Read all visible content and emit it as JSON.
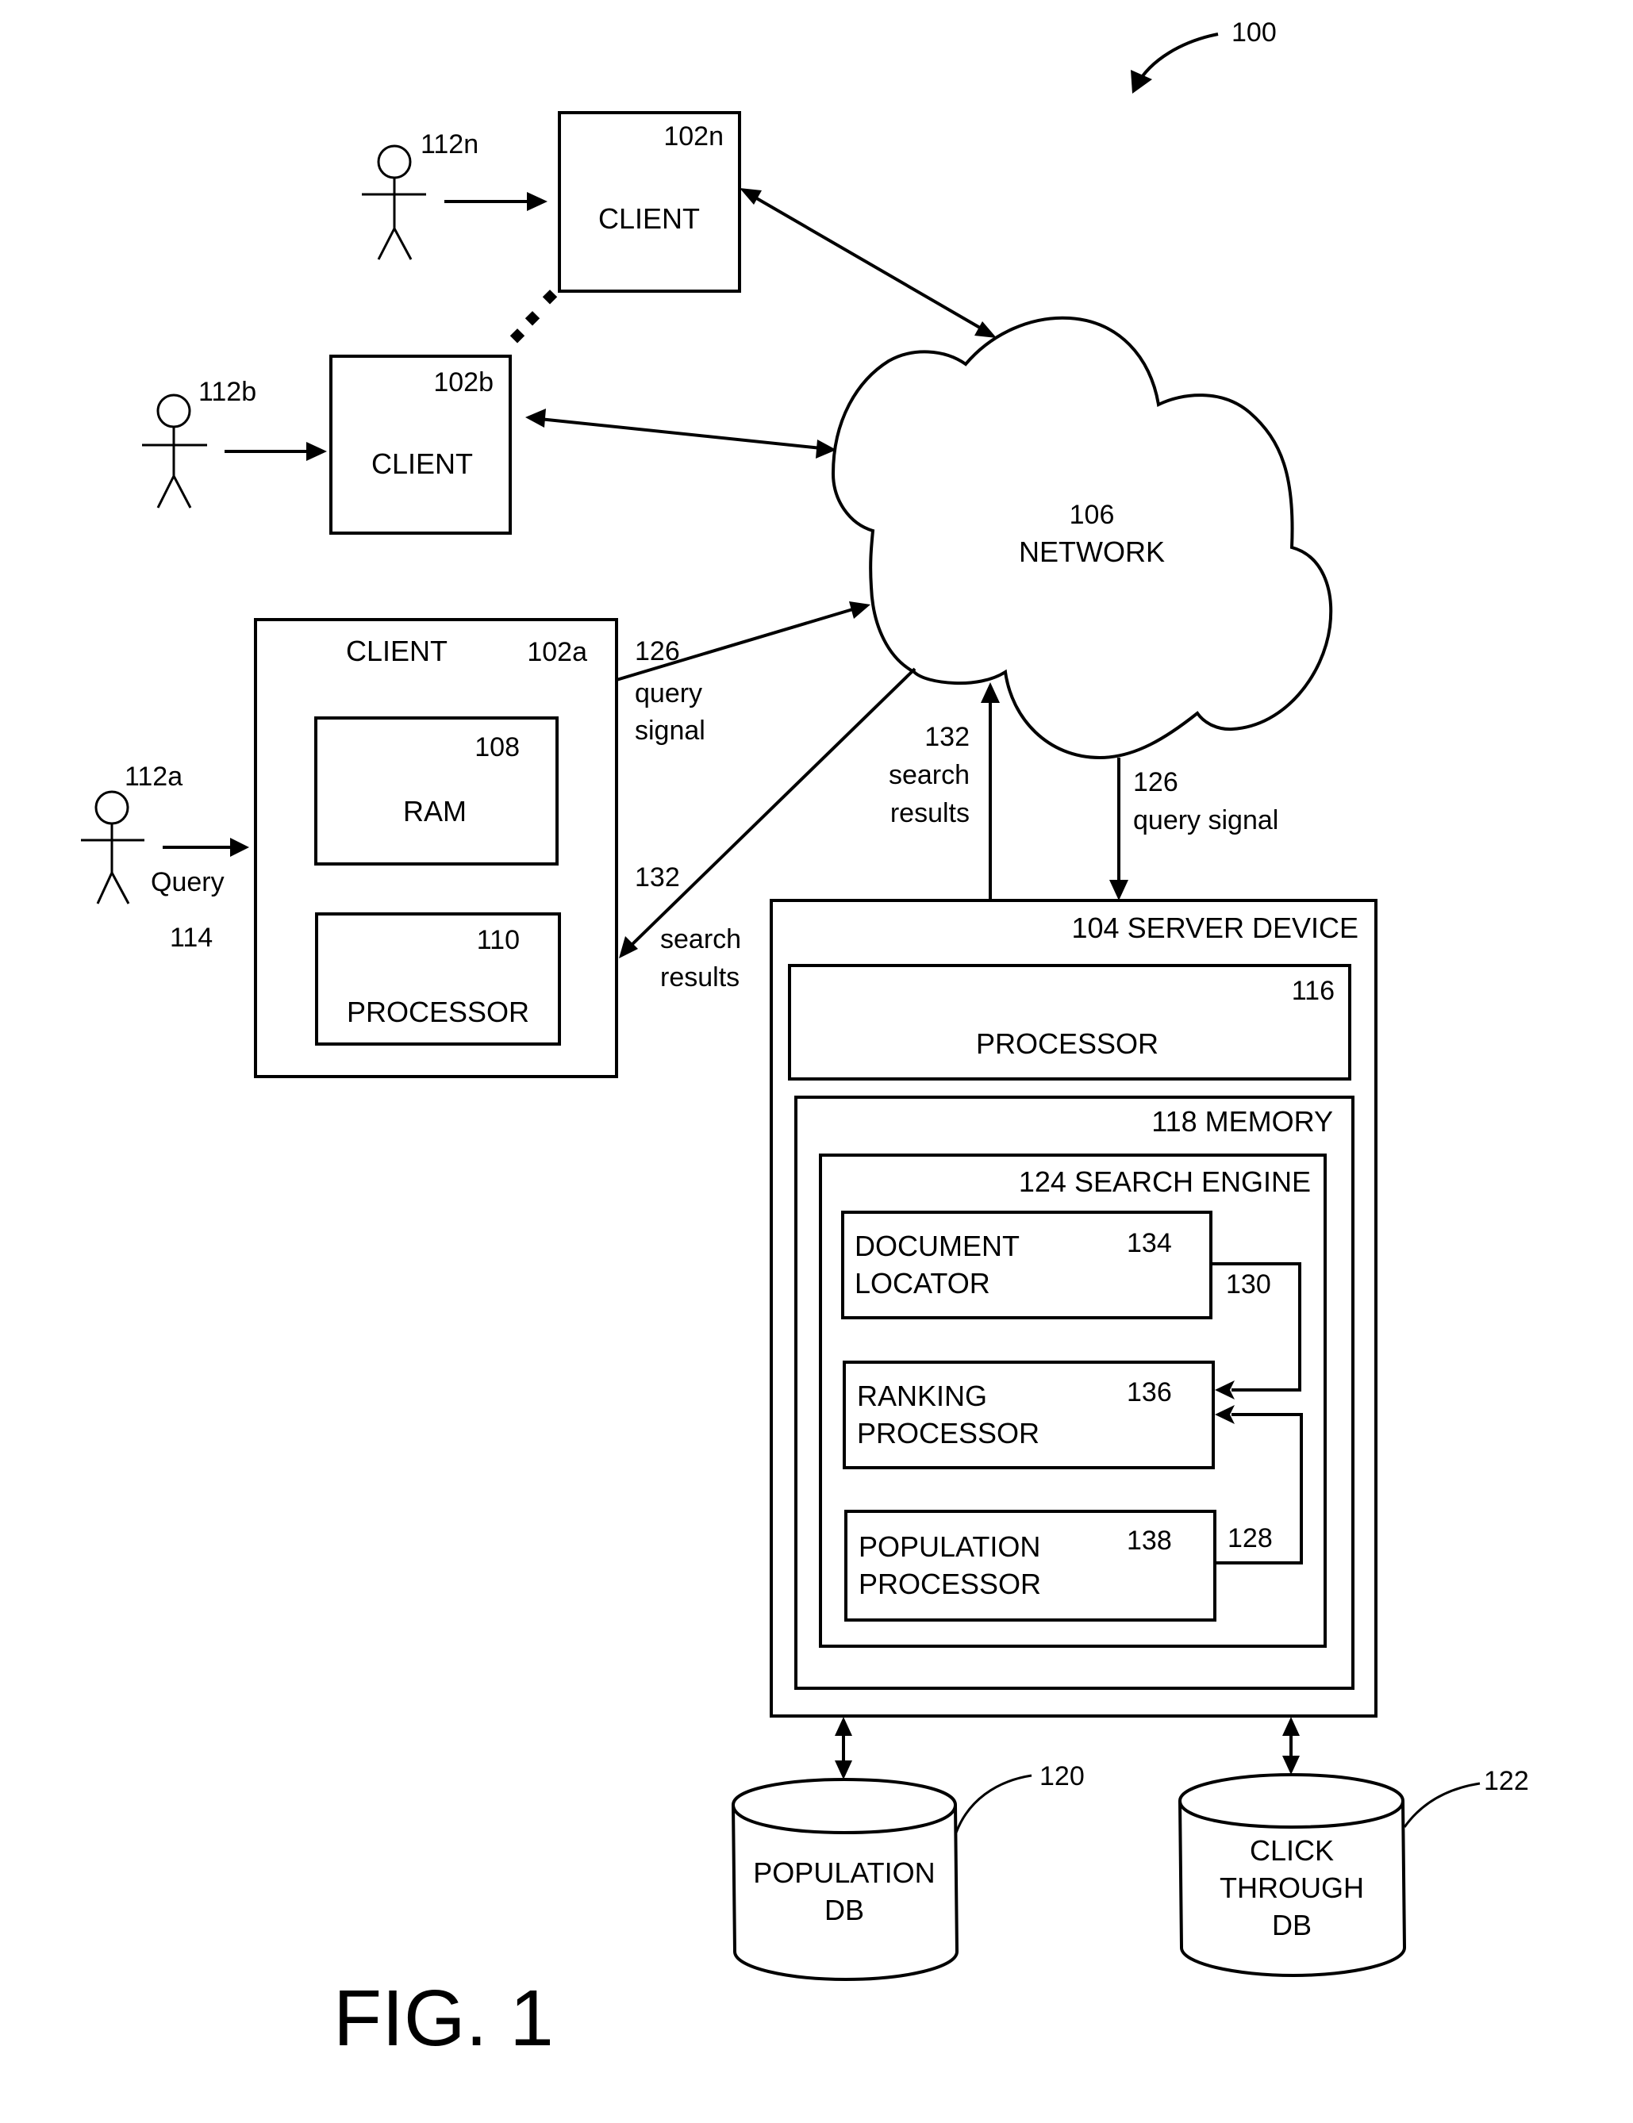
{
  "figure": {
    "title": "FIG. 1",
    "system_ref": "100"
  },
  "users": [
    {
      "ref": "112n"
    },
    {
      "ref": "112b"
    },
    {
      "ref": "112a"
    }
  ],
  "query_input": {
    "label": "Query",
    "ref": "114"
  },
  "clients": [
    {
      "ref": "102n",
      "label": "CLIENT"
    },
    {
      "ref": "102b",
      "label": "CLIENT"
    },
    {
      "ref": "102a",
      "label": "CLIENT",
      "components": [
        {
          "ref": "108",
          "label": "RAM"
        },
        {
          "ref": "110",
          "label": "PROCESSOR"
        }
      ]
    }
  ],
  "network": {
    "ref": "106",
    "label": "NETWORK"
  },
  "signals": {
    "client_query": {
      "ref": "126",
      "line1": "query",
      "line2": "signal"
    },
    "client_results": {
      "ref": "132",
      "line1": "search",
      "line2": "results"
    },
    "server_results": {
      "ref": "132",
      "line1": "search",
      "line2": "results"
    },
    "server_query": {
      "ref": "126",
      "label": "query signal"
    }
  },
  "server": {
    "label": "104 SERVER DEVICE",
    "processor": {
      "ref": "116",
      "label": "PROCESSOR"
    },
    "memory": {
      "label": "118 MEMORY",
      "search_engine": {
        "label": "124 SEARCH ENGINE",
        "modules": [
          {
            "ref": "134",
            "line1": "DOCUMENT",
            "line2": "LOCATOR"
          },
          {
            "ref": "136",
            "line1": "RANKING",
            "line2": "PROCESSOR"
          },
          {
            "ref": "138",
            "line1": "POPULATION",
            "line2": "PROCESSOR"
          }
        ],
        "connectors": [
          {
            "ref": "130"
          },
          {
            "ref": "128"
          }
        ]
      }
    }
  },
  "databases": [
    {
      "ref": "120",
      "lines": [
        "POPULATION",
        "DB"
      ]
    },
    {
      "ref": "122",
      "lines": [
        "CLICK",
        "THROUGH",
        "DB"
      ]
    }
  ]
}
